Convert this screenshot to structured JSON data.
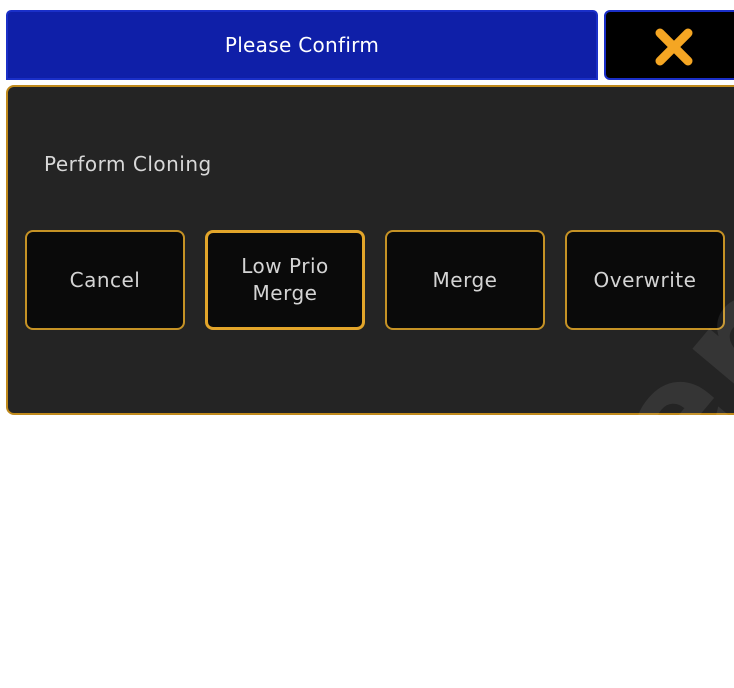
{
  "dialog": {
    "title": "Please Confirm",
    "close_icon": "close-x-icon",
    "message": "Perform Cloning",
    "buttons": [
      {
        "label": "Cancel"
      },
      {
        "label": "Low Prio\nMerge"
      },
      {
        "label": "Merge"
      },
      {
        "label": "Overwrite"
      }
    ]
  },
  "watermark": "Reemendo",
  "colors": {
    "title_bar": "#0f1fa8",
    "accent_border": "#c59225",
    "close_icon": "#f5a623",
    "dialog_bg": "#242424"
  }
}
